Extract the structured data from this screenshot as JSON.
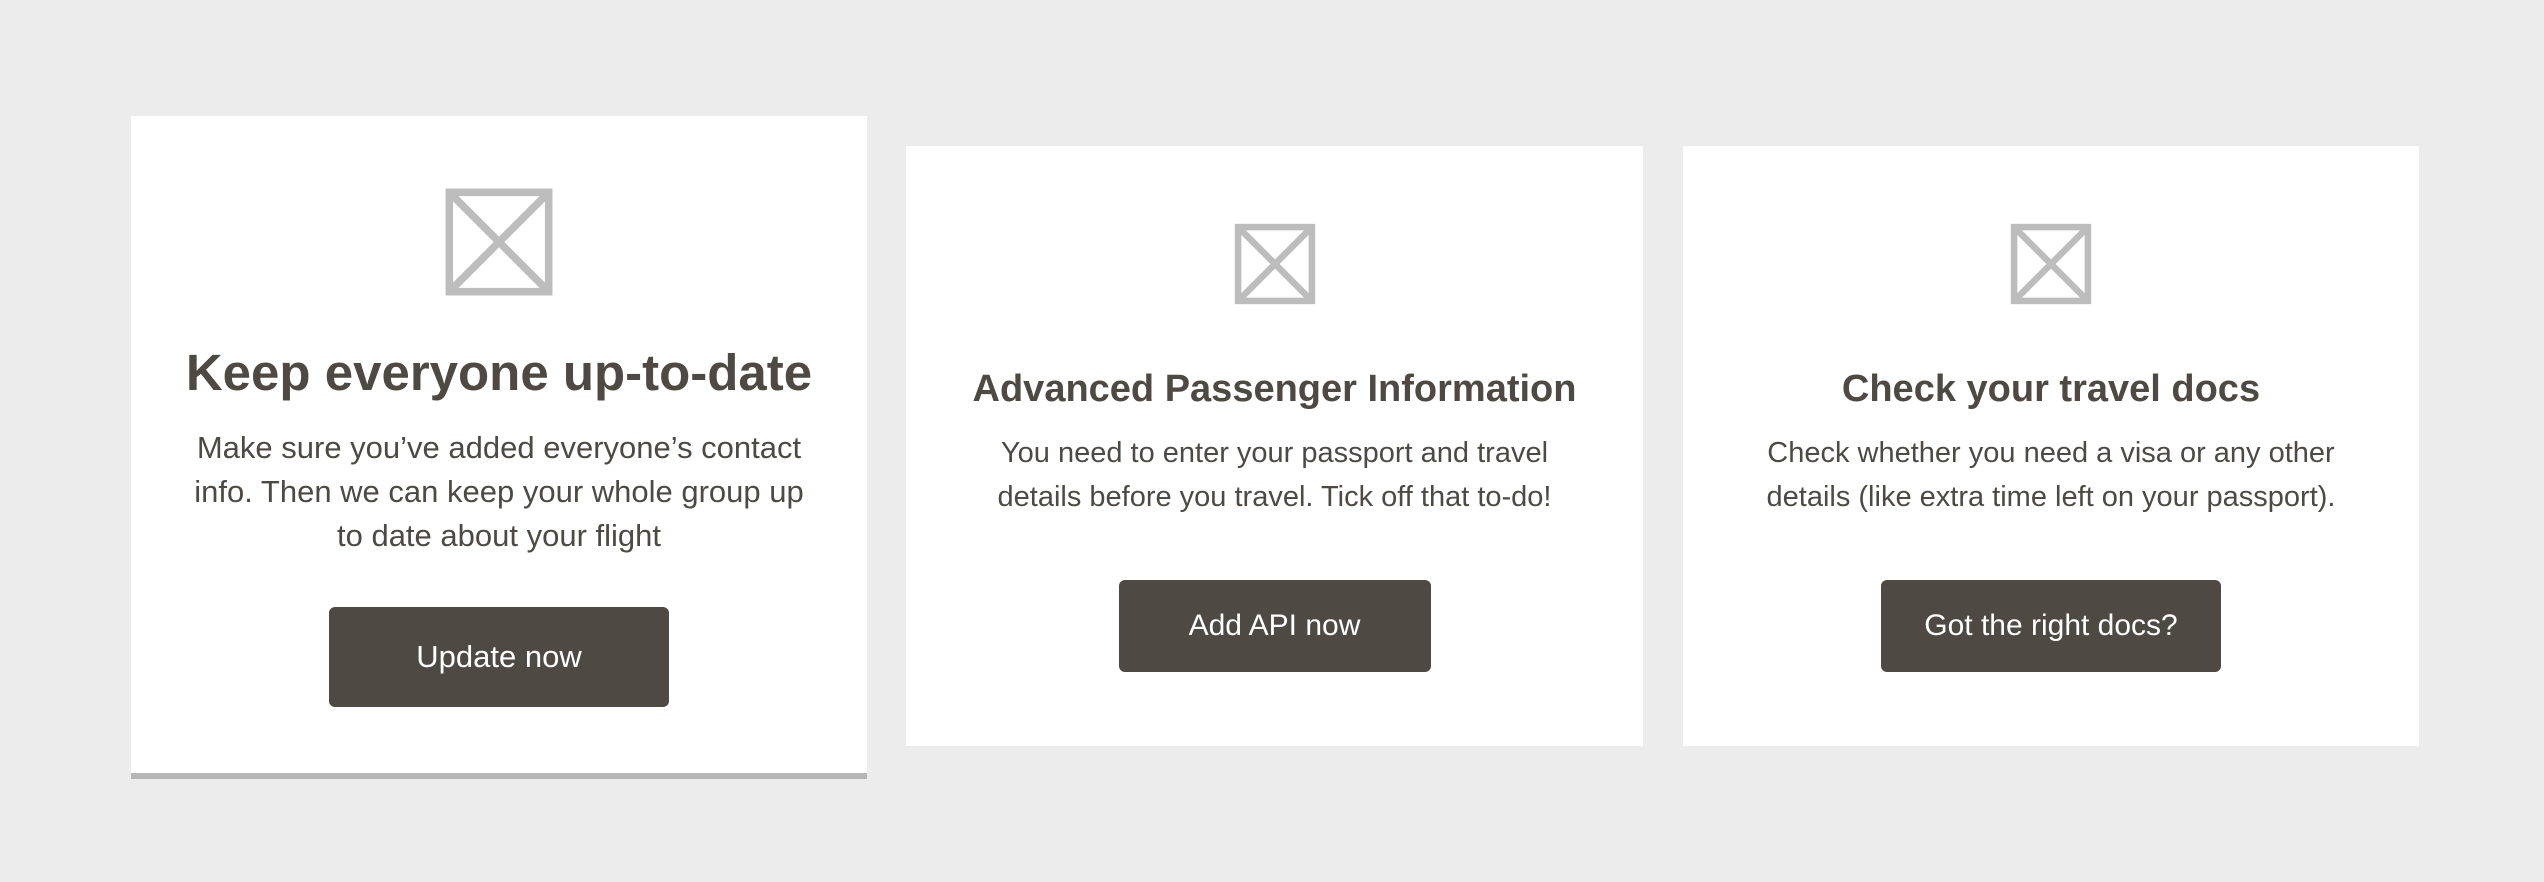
{
  "cards": [
    {
      "icon": "image-placeholder-icon",
      "title": "Keep everyone up-to-date",
      "description": "Make sure you’ve added everyone’s contact info. Then we can keep your whole group up to date about your flight",
      "button_label": "Update now"
    },
    {
      "icon": "image-placeholder-icon",
      "title": "Advanced Passenger Information",
      "description": "You need to enter your passport and travel details before you travel. Tick off that to-do!",
      "button_label": "Add API now"
    },
    {
      "icon": "image-placeholder-icon",
      "title": "Check your travel docs",
      "description": "Check whether you need a visa or any other details (like extra time left on your passport).",
      "button_label": "Got the right docs?"
    }
  ],
  "colors": {
    "background": "#ececec",
    "card": "#ffffff",
    "text": "#4e4943",
    "button": "#4e4943",
    "button_text": "#ffffff",
    "placeholder": "#bdbdbd",
    "featured_underline": "#b6b6b6"
  }
}
